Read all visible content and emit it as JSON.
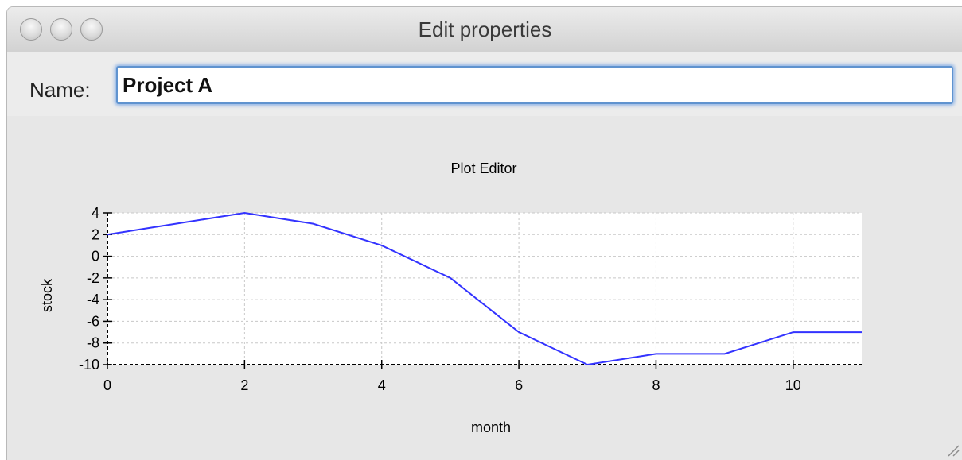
{
  "window": {
    "title": "Edit properties"
  },
  "form": {
    "name_label": "Name:",
    "name_value": "Project A"
  },
  "chart_data": {
    "type": "line",
    "title": "Plot Editor",
    "xlabel": "month",
    "ylabel": "stock",
    "xlim": [
      0,
      11
    ],
    "ylim": [
      -10,
      4
    ],
    "x_ticks": [
      0,
      2,
      4,
      6,
      8,
      10
    ],
    "y_ticks": [
      4,
      2,
      0,
      -2,
      -4,
      -6,
      -8,
      -10
    ],
    "grid": true,
    "series": [
      {
        "color": "#3333ff",
        "x": [
          0,
          1,
          2,
          3,
          4,
          5,
          6,
          7,
          8,
          9,
          10,
          11
        ],
        "y": [
          2,
          3,
          4,
          3,
          1,
          -2,
          -7,
          -10,
          -9,
          -9,
          -7,
          -7
        ]
      }
    ]
  }
}
